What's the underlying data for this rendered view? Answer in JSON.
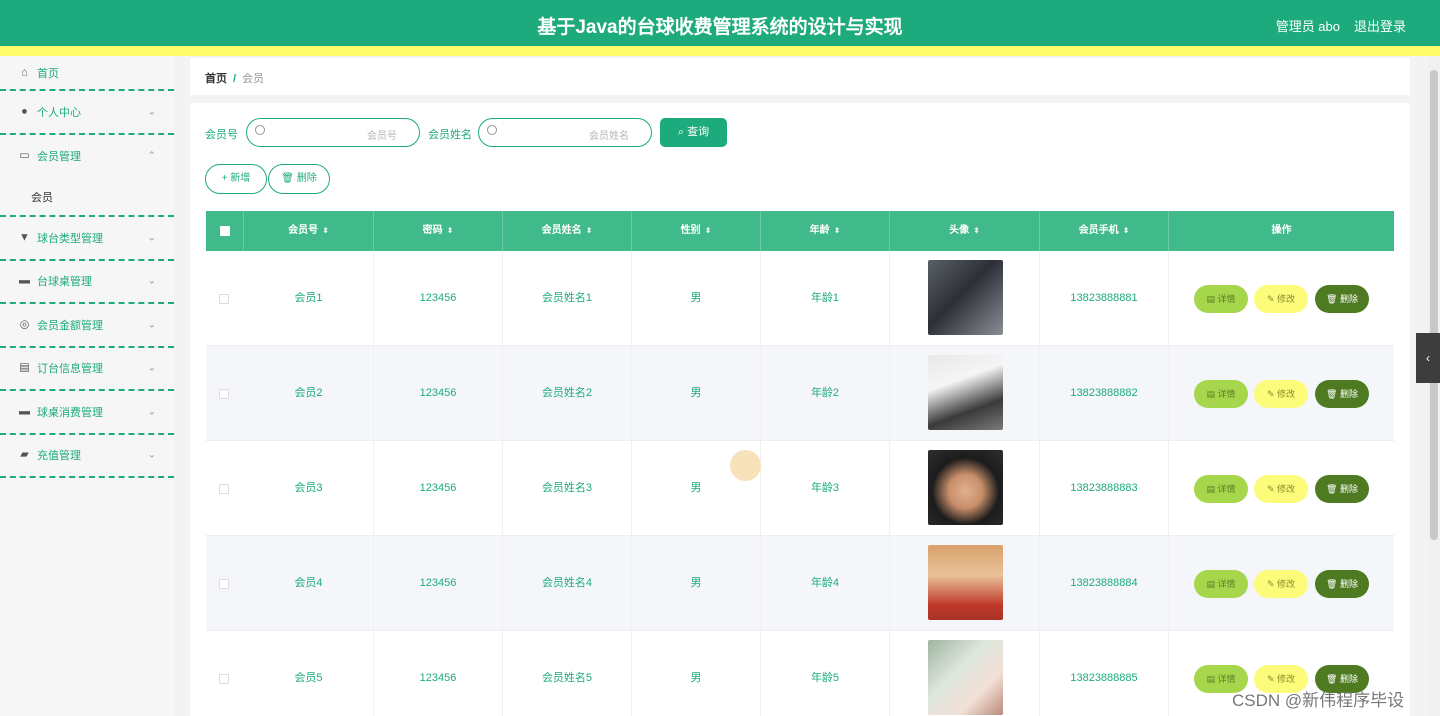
{
  "header": {
    "title": "基于Java的台球收费管理系统的设计与实现",
    "user": "管理员 abo",
    "logout": "退出登录"
  },
  "sidebar": {
    "home": "首页",
    "items": [
      {
        "label": "个人中心",
        "icon": "user-icon"
      },
      {
        "label": "会员管理",
        "icon": "chat-icon",
        "open": true,
        "sub": [
          "会员"
        ]
      },
      {
        "label": "球台类型管理",
        "icon": "table-type-icon"
      },
      {
        "label": "台球桌管理",
        "icon": "monitor-icon"
      },
      {
        "label": "会员金额管理",
        "icon": "compass-icon"
      },
      {
        "label": "订台信息管理",
        "icon": "card-icon"
      },
      {
        "label": "球桌消费管理",
        "icon": "message-icon"
      },
      {
        "label": "充值管理",
        "icon": "briefcase-icon"
      }
    ]
  },
  "breadcrumb": {
    "home": "首页",
    "sep": "/",
    "current": "会员"
  },
  "search": {
    "member_no_label": "会员号",
    "member_no_placeholder": "会员号",
    "member_name_label": "会员姓名",
    "member_name_placeholder": "会员姓名",
    "query": "查询"
  },
  "toolbar": {
    "add": "+ 新增",
    "delete": "🗑 删除"
  },
  "table": {
    "columns": [
      "会员号",
      "密码",
      "会员姓名",
      "性别",
      "年龄",
      "头像",
      "会员手机",
      "操作"
    ],
    "rows": [
      {
        "no": "会员1",
        "pwd": "123456",
        "name": "会员姓名1",
        "sex": "男",
        "age": "年龄1",
        "phone": "13823888881"
      },
      {
        "no": "会员2",
        "pwd": "123456",
        "name": "会员姓名2",
        "sex": "男",
        "age": "年龄2",
        "phone": "13823888882"
      },
      {
        "no": "会员3",
        "pwd": "123456",
        "name": "会员姓名3",
        "sex": "男",
        "age": "年龄3",
        "phone": "13823888883"
      },
      {
        "no": "会员4",
        "pwd": "123456",
        "name": "会员姓名4",
        "sex": "男",
        "age": "年龄4",
        "phone": "13823888884"
      },
      {
        "no": "会员5",
        "pwd": "123456",
        "name": "会员姓名5",
        "sex": "男",
        "age": "年龄5",
        "phone": "13823888885"
      }
    ],
    "actions": {
      "detail": "详情",
      "edit": "修改",
      "delete": "删除"
    }
  },
  "watermark": "CSDN @新伟程序毕设",
  "colors": {
    "primary": "#1dab7e",
    "accent_yellow": "#fffb6b",
    "header_table": "#40b98b"
  }
}
